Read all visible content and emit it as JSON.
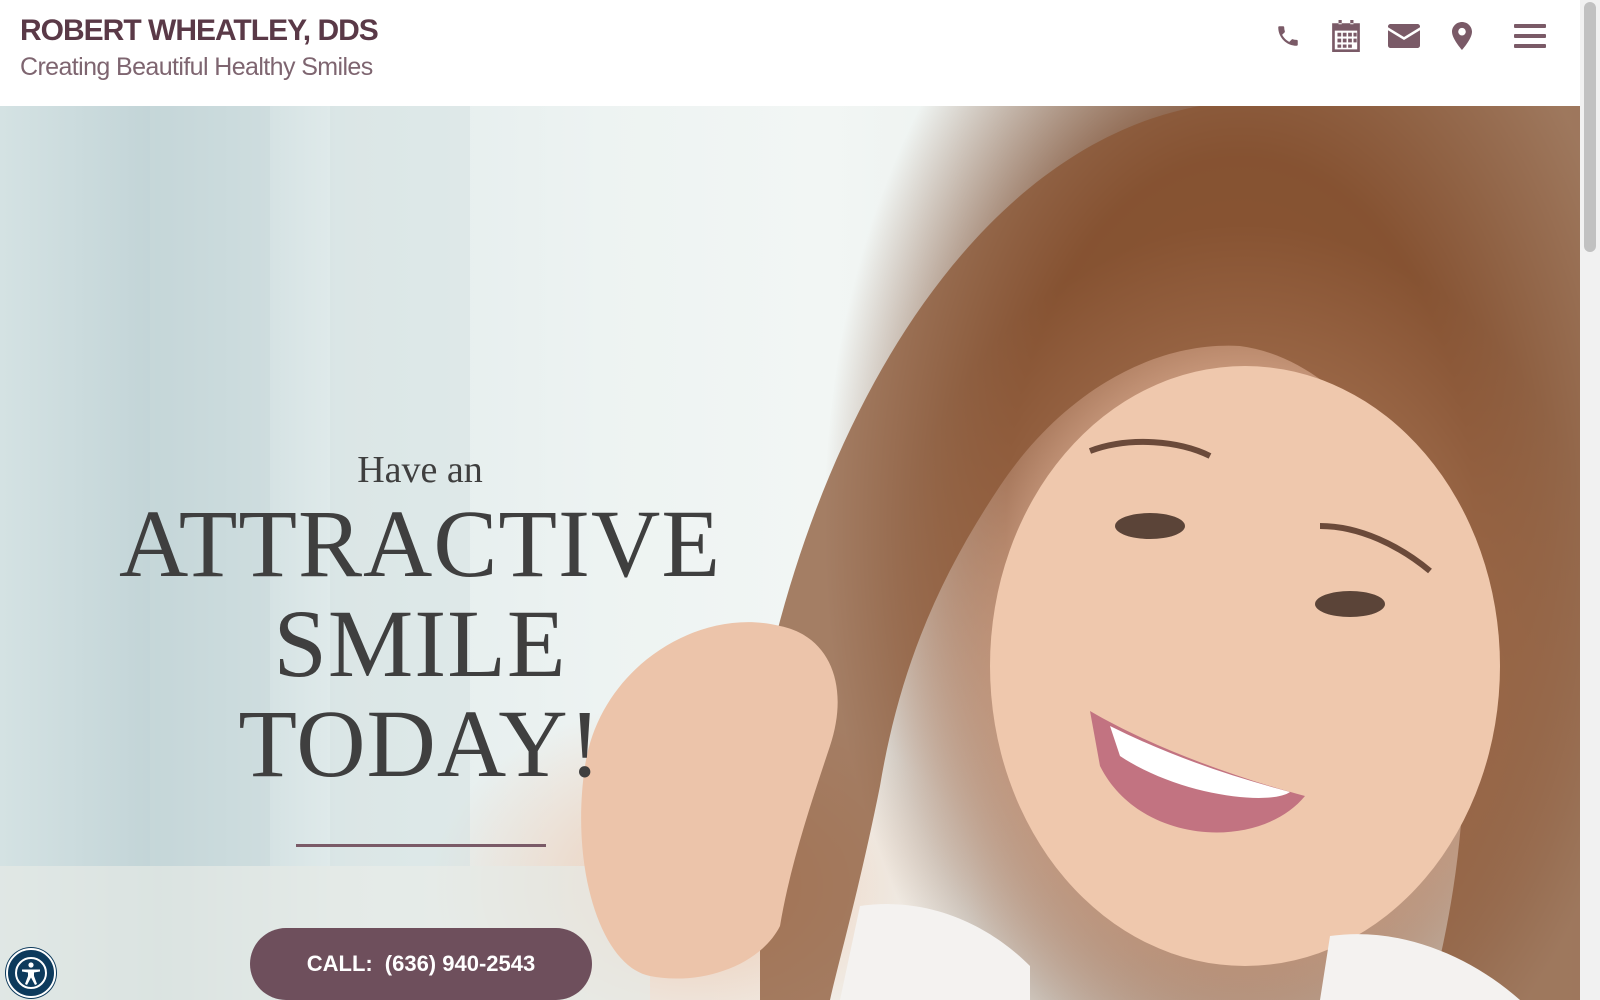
{
  "header": {
    "brand_name": "ROBERT WHEATLEY, DDS",
    "tagline": "Creating Beautiful Healthy Smiles",
    "icons": [
      "phone-icon",
      "calendar-icon",
      "envelope-icon",
      "map-pin-icon",
      "hamburger-menu-icon"
    ]
  },
  "hero": {
    "line1": "Have an",
    "line2": "ATTRACTIVE",
    "line3": "SMILE",
    "line4": "TODAY!",
    "cta_label": "CALL:",
    "cta_phone": "(636) 940-2543"
  },
  "colors": {
    "brand": "#5a3947",
    "accent": "#6e4f5c",
    "hero_text": "#3f3f3f",
    "a11y": "#0d3a5c"
  },
  "accessibility_button": {
    "icon": "accessibility-icon"
  }
}
